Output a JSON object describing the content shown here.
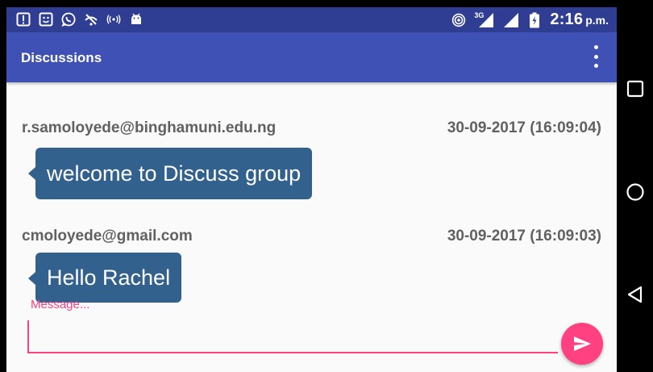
{
  "status_bar": {
    "time": "2:16",
    "ampm": "p.m.",
    "network_label": "3G",
    "left_icons": [
      "alert-icon",
      "sim-icon",
      "whatsapp-icon",
      "wifi-off-icon",
      "broadcast-icon",
      "android-icon"
    ],
    "right_icons": [
      "hotspot-icon",
      "signal-3g-icon",
      "signal-icon",
      "battery-icon"
    ]
  },
  "appbar": {
    "title": "Discussions",
    "overflow_icon": "overflow-menu-icon"
  },
  "messages": [
    {
      "sender": "r.samoloyede@binghamuni.edu.ng",
      "time": "30-09-2017 (16:09:04)",
      "text": "welcome to Discuss group"
    },
    {
      "sender": "cmoloyede@gmail.com",
      "time": "30-09-2017 (16:09:03)",
      "text": "Hello Rachel"
    }
  ],
  "composer": {
    "placeholder": "Message...",
    "value": "",
    "send_icon": "send-icon"
  },
  "navbar": {
    "icons": [
      "recents-icon",
      "home-icon",
      "back-icon"
    ]
  },
  "colors": {
    "status_bar": "#2f3e92",
    "app_bar": "#3f51b5",
    "bubble": "#33618d",
    "accent": "#ff4081"
  }
}
